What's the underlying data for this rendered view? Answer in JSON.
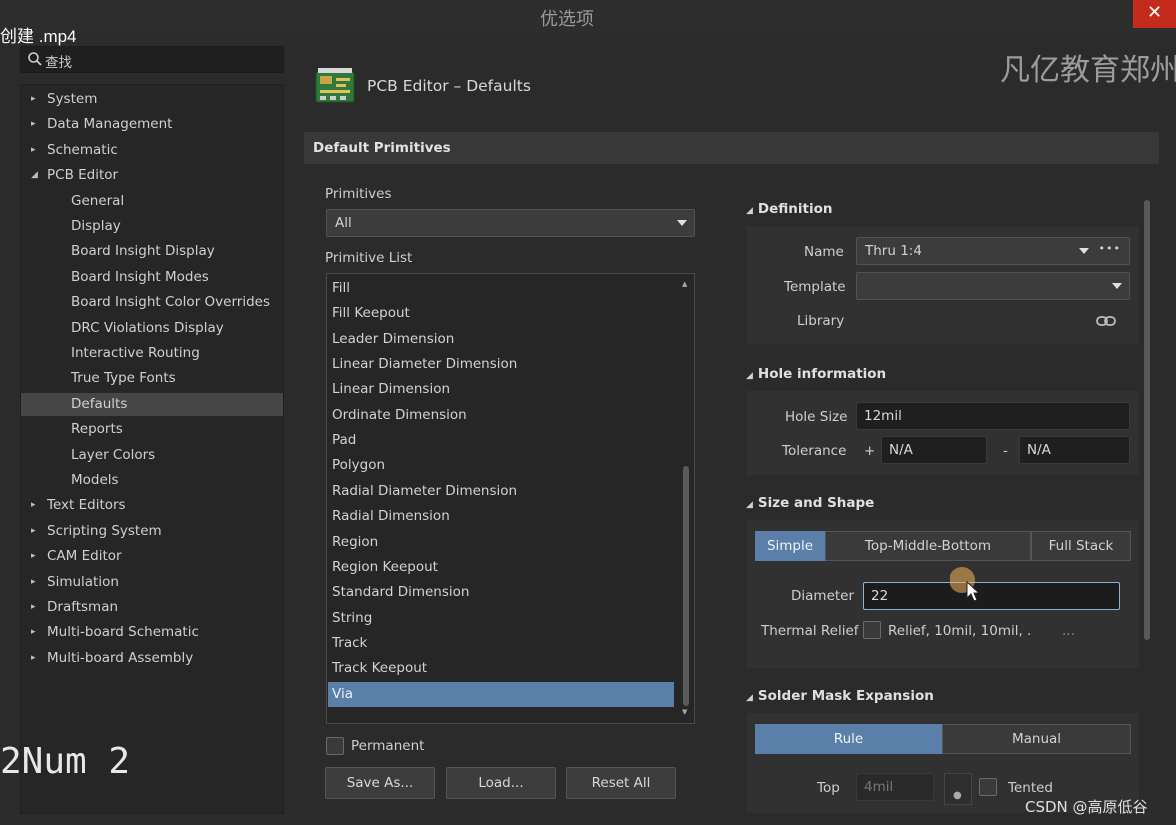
{
  "window": {
    "title": "优选项",
    "close_glyph": "✕",
    "video_caption": "创建 .mp4",
    "watermark_top": "凡亿教育郑州",
    "watermark_bottom": "CSDN @高原低谷",
    "overlay_text": "2Num 2"
  },
  "search": {
    "placeholder": "查找",
    "icon": "search-icon"
  },
  "nav": {
    "items": [
      {
        "label": "System",
        "expanded": false
      },
      {
        "label": "Data Management",
        "expanded": false
      },
      {
        "label": "Schematic",
        "expanded": false
      },
      {
        "label": "PCB Editor",
        "expanded": true
      },
      {
        "label": "General"
      },
      {
        "label": "Display"
      },
      {
        "label": "Board Insight Display"
      },
      {
        "label": "Board Insight Modes"
      },
      {
        "label": "Board Insight Color Overrides"
      },
      {
        "label": "DRC Violations Display"
      },
      {
        "label": "Interactive Routing"
      },
      {
        "label": "True Type Fonts"
      },
      {
        "label": "Defaults",
        "selected": true
      },
      {
        "label": "Reports"
      },
      {
        "label": "Layer Colors"
      },
      {
        "label": "Models"
      },
      {
        "label": "Text Editors",
        "expanded": false
      },
      {
        "label": "Scripting System",
        "expanded": false
      },
      {
        "label": "CAM Editor",
        "expanded": false
      },
      {
        "label": "Simulation",
        "expanded": false
      },
      {
        "label": "Draftsman",
        "expanded": false
      },
      {
        "label": "Multi-board Schematic",
        "expanded": false
      },
      {
        "label": "Multi-board Assembly",
        "expanded": false
      }
    ]
  },
  "page": {
    "heading": "PCB Editor – Defaults",
    "icon": "pcb-board-icon",
    "section_title": "Default Primitives"
  },
  "primitives": {
    "label": "Primitives",
    "selected": "All",
    "list_label": "Primitive List",
    "items": [
      "Fill",
      "Fill Keepout",
      "Leader Dimension",
      "Linear Diameter Dimension",
      "Linear Dimension",
      "Ordinate Dimension",
      "Pad",
      "Polygon",
      "Radial Diameter Dimension",
      "Radial Dimension",
      "Region",
      "Region Keepout",
      "Standard Dimension",
      "String",
      "Track",
      "Track Keepout",
      "Via"
    ],
    "selected_item": "Via",
    "permanent_label": "Permanent",
    "permanent_checked": false,
    "buttons": {
      "save_as": "Save As...",
      "load": "Load...",
      "reset_all": "Reset All"
    }
  },
  "definition": {
    "title": "Definition",
    "name_label": "Name",
    "name_value": "Thru 1:4",
    "more_glyph": "•••",
    "template_label": "Template",
    "template_value": "",
    "library_label": "Library",
    "library_icon": "link-icon"
  },
  "hole": {
    "title": "Hole information",
    "size_label": "Hole Size",
    "size_value": "12mil",
    "tolerance_label": "Tolerance",
    "plus_sign": "+",
    "minus_sign": "-",
    "tol_plus_value": "N/A",
    "tol_minus_value": "N/A"
  },
  "size_shape": {
    "title": "Size and Shape",
    "modes": [
      "Simple",
      "Top-Middle-Bottom",
      "Full Stack"
    ],
    "active_mode": "Simple",
    "diameter_label": "Diameter",
    "diameter_value": "22",
    "thermal_label": "Thermal Relief",
    "thermal_value": "Relief, 10mil, 10mil, .",
    "thermal_more": "..."
  },
  "solder_mask": {
    "title": "Solder Mask Expansion",
    "modes": [
      "Rule",
      "Manual"
    ],
    "active_mode": "Rule",
    "top_label": "Top",
    "top_value": "4mil",
    "tented_label": "Tented"
  },
  "colors": {
    "accent": "#5a7fa8",
    "close": "#c42b1c",
    "background": "#2b2b2b"
  }
}
